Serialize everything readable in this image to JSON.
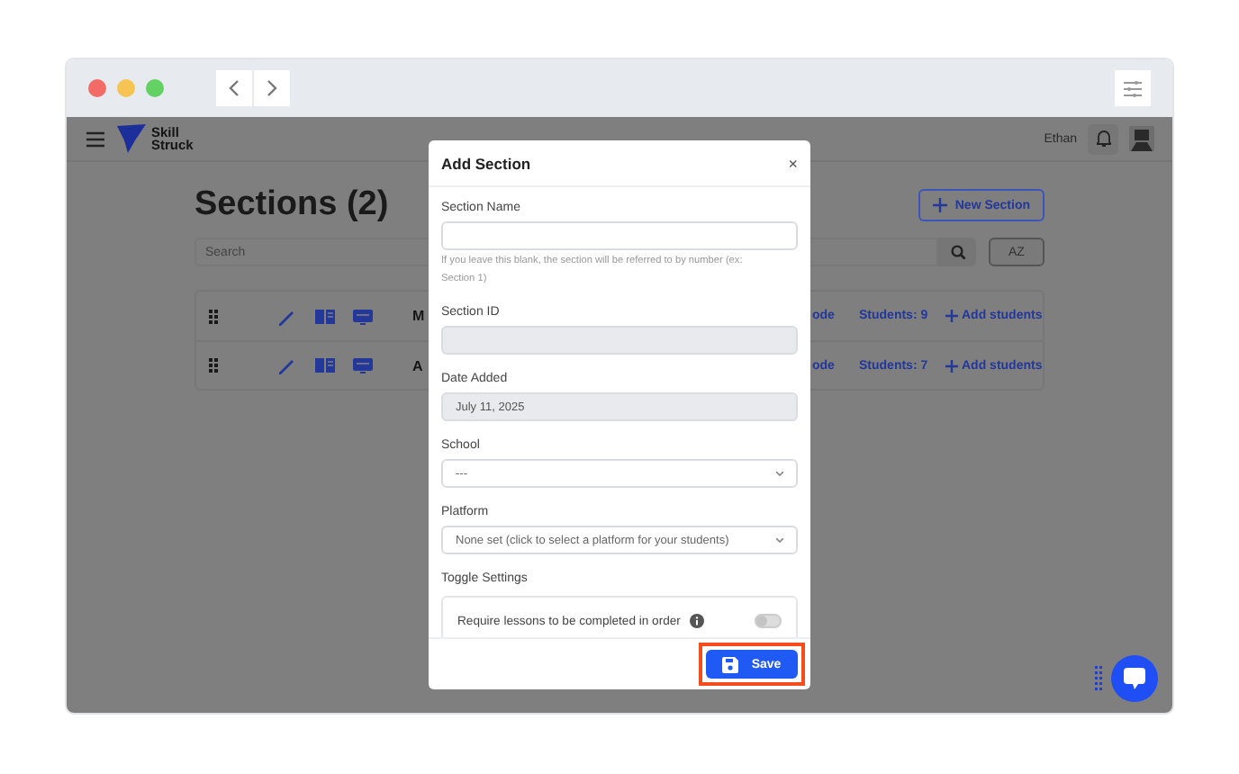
{
  "app": {
    "logo": [
      "Skill",
      "Struck"
    ],
    "user_name": "Ethan"
  },
  "page": {
    "title": "Sections (2)",
    "new_button": "New Section",
    "search": {
      "placeholder": "Search"
    },
    "sort_button": "AZ",
    "rows": [
      {
        "name": "M",
        "column_3": "ode",
        "students": "Students: 9",
        "action": "Add students"
      },
      {
        "name": "A",
        "column_3": "ode",
        "students": "Students: 7",
        "action": "Add students"
      }
    ]
  },
  "modal": {
    "title": "Add Section",
    "close": "×",
    "fields": [
      {
        "kind": "text",
        "label": "Section Name",
        "hint": "If you leave this blank, the section will be referred to by number (ex: Section 1)"
      },
      {
        "kind": "readonly",
        "label": "Section ID"
      },
      {
        "kind": "readonly",
        "label": "Date Added",
        "value": "July 11, 2025"
      },
      {
        "kind": "select",
        "label": "School",
        "value": "---"
      },
      {
        "kind": "select",
        "label": "Platform",
        "value": "None set (click to select a platform for your students)"
      }
    ],
    "toggle_heading": "Toggle Settings",
    "toggles": [
      {
        "label": "Require lessons to be completed in order",
        "on": false
      }
    ],
    "save_button": {
      "label": "Save",
      "highlighted": true
    }
  }
}
